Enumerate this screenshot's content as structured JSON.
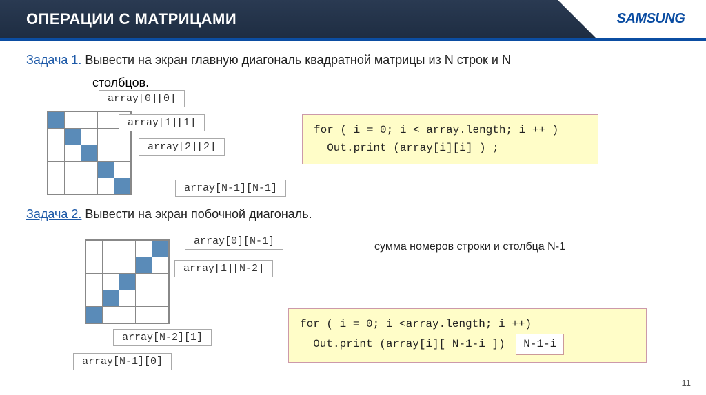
{
  "header": {
    "title": "ОПЕРАЦИИ С МАТРИЦАМИ",
    "logo": "SAMSUNG"
  },
  "task1": {
    "label": "Задача 1.",
    "text1": " Вывести на экран главную диагональ квадратной матрицы из N строк и N",
    "text2": "столбцов."
  },
  "callouts1": {
    "c00": "array[0][0]",
    "c11": "array[1][1]",
    "c22": "array[2][2]",
    "cnn": "array[N-1][N-1]"
  },
  "code1": {
    "line1": "for ( i = 0;  i < array.length;  i ++ )",
    "line2": "  Out.print (array[i][i] ) ;"
  },
  "task2": {
    "label": "Задача 2.",
    "text": " Вывести на экран побочной диагональ."
  },
  "callouts2": {
    "c0n": "array[0][N-1]",
    "c1n": "array[1][N-2]",
    "cn2": "array[N-2][1]",
    "cn1": "array[N-1][0]"
  },
  "note": "сумма номеров строки и столбца N-1",
  "code2": {
    "line1": "for ( i = 0;  i <array.length;  i ++)",
    "line2a": "  Out.print (array[i][ N-1-i ])",
    "hl": "N-1-i"
  },
  "page": "11"
}
